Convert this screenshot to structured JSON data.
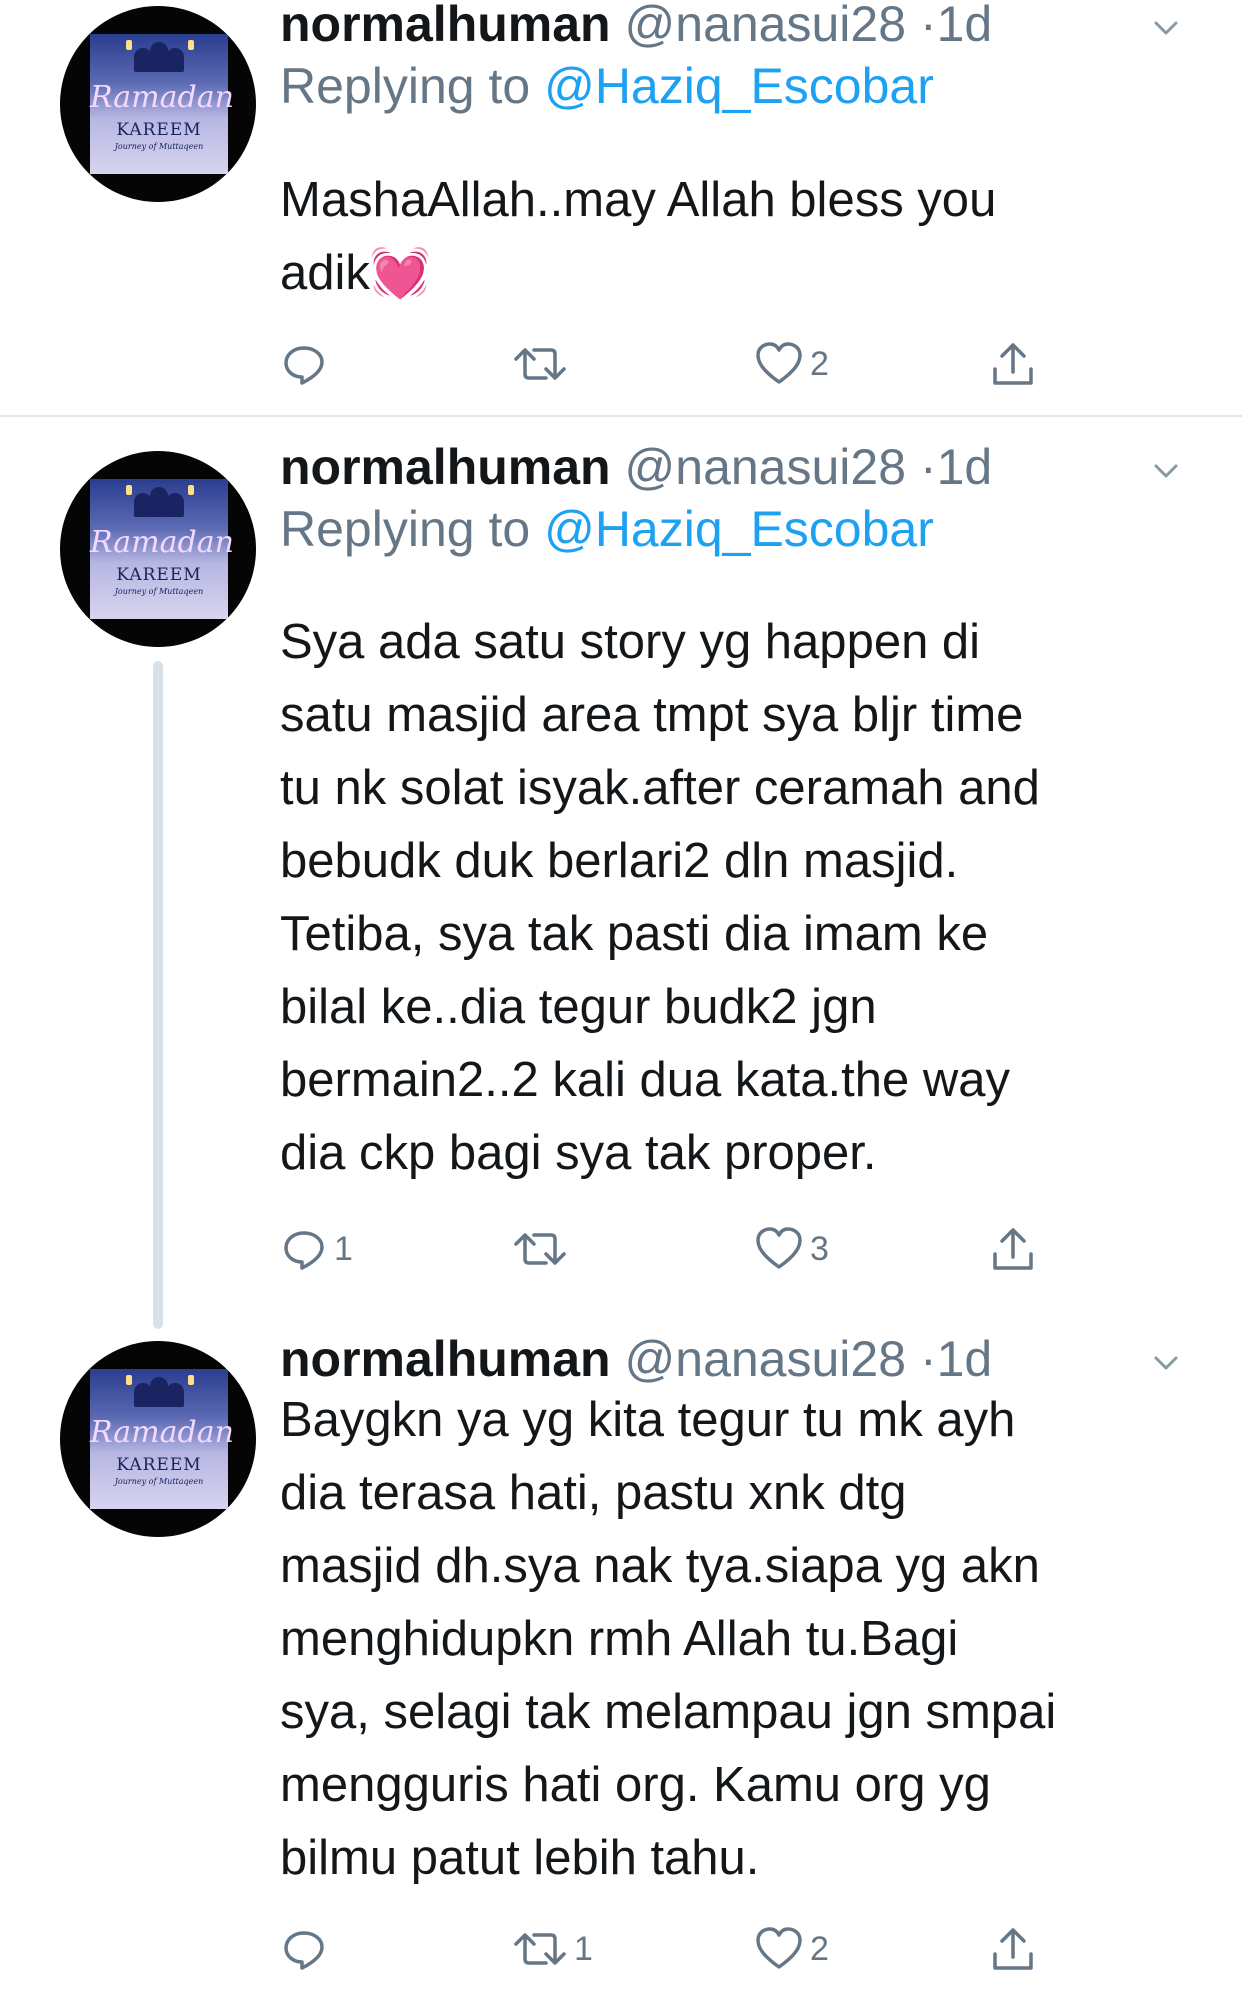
{
  "tweets": [
    {
      "name": "normalhuman",
      "handle": "@nanasui28",
      "separator": "·",
      "time": "1d",
      "reply_prefix": "Replying to",
      "reply_to": "@Haziq_Escobar",
      "lines": [
        "MashaAllah..may Allah bless you",
        "adik💓"
      ],
      "replies": "",
      "retweets": "",
      "likes": "2"
    },
    {
      "name": "normalhuman",
      "handle": "@nanasui28",
      "separator": "·",
      "time": "1d",
      "reply_prefix": "Replying to",
      "reply_to": "@Haziq_Escobar",
      "lines": [
        "Sya ada satu story yg happen di",
        "satu masjid area tmpt sya bljr time",
        "tu nk solat isyak.after ceramah and",
        "bebudk duk berlari2 dln masjid.",
        "Tetiba, sya tak pasti dia imam ke",
        "bilal ke..dia tegur budk2 jgn",
        "bermain2..2 kali dua kata.the way",
        "dia ckp bagi sya tak proper."
      ],
      "replies": "1",
      "retweets": "",
      "likes": "3"
    },
    {
      "name": "normalhuman",
      "handle": "@nanasui28",
      "separator": "·",
      "time": "1d",
      "lines": [
        "Baygkn ya yg kita tegur tu mk ayh",
        "dia terasa hati, pastu xnk dtg",
        "masjid dh.sya nak tya.siapa yg akn",
        "menghidupkn rmh Allah tu.Bagi",
        "sya, selagi tak melampau jgn smpai",
        "mengguris hati org. Kamu org yg",
        "bilmu patut lebih tahu."
      ],
      "replies": "",
      "retweets": "1",
      "likes": "2"
    }
  ],
  "avatar": {
    "script_text": "Ramadan",
    "title_text": "KAREEM",
    "subtitle_text": "Journey of Muttaqeen"
  },
  "icons": {
    "reply": "reply-icon",
    "retweet": "retweet-icon",
    "like": "heart-icon",
    "share": "share-icon",
    "caret": "chevron-down-icon"
  },
  "colors": {
    "text": "#14171a",
    "muted": "#657786",
    "link": "#1da1f2",
    "divider": "#e1e8ed",
    "thread_line": "#d9e1e8"
  }
}
